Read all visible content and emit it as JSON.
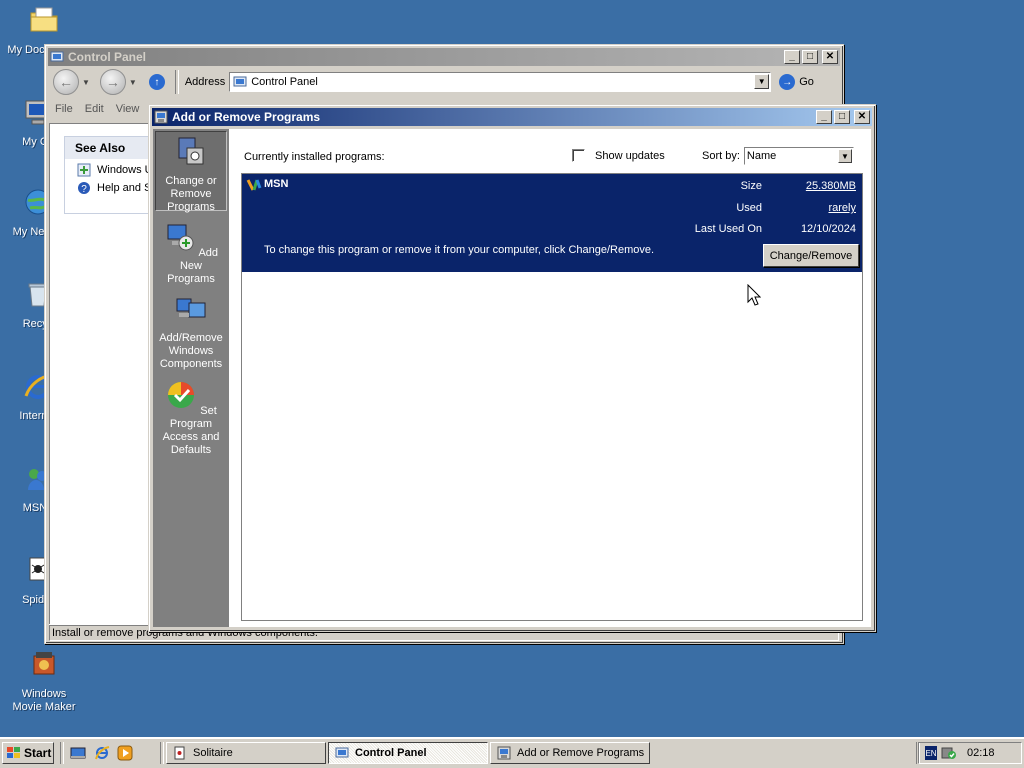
{
  "desktop": {
    "icons": [
      {
        "label": "My Documents",
        "icon": "folder-icon"
      },
      {
        "label": "My Co",
        "icon": "computer-icon"
      },
      {
        "label": "My Ne Pla",
        "icon": "network-places-icon"
      },
      {
        "label": "Recyc",
        "icon": "recycle-bin-icon"
      },
      {
        "label": "Internet",
        "icon": "internet-explorer-icon"
      },
      {
        "label": "MSN I",
        "icon": "msn-icon"
      },
      {
        "label": "Spider",
        "icon": "spider-solitaire-icon"
      },
      {
        "label": "Windows Movie Maker",
        "icon": "movie-maker-icon"
      }
    ]
  },
  "control_panel": {
    "title": "Control Panel",
    "address_label": "Address",
    "address_value": "Control Panel",
    "go_label": "Go",
    "menu": [
      "File",
      "Edit",
      "View"
    ],
    "see_also": {
      "header": "See Also",
      "items": [
        "Windows U",
        "Help and S"
      ]
    },
    "status_text": "Install or remove programs and Windows components."
  },
  "arp": {
    "title": "Add or Remove Programs",
    "side_buttons": [
      {
        "label": "Change or Remove Programs",
        "icon": "change-remove-programs-icon"
      },
      {
        "label": "Add New Programs",
        "icon": "add-new-programs-icon"
      },
      {
        "label": "Add/Remove Windows Components",
        "icon": "windows-components-icon"
      },
      {
        "label": "Set Program Access and Defaults",
        "icon": "program-access-defaults-icon"
      }
    ],
    "currently_installed_label": "Currently installed programs:",
    "show_updates_label": "Show updates",
    "show_updates_checked": false,
    "sort_by_label": "Sort by:",
    "sort_by_value": "Name",
    "program": {
      "name": "MSN",
      "size_label": "Size",
      "size_value": "25.380MB",
      "used_label": "Used",
      "used_value": "rarely",
      "last_used_label": "Last Used On",
      "last_used_value": "12/10/2024",
      "description": "To change this program or remove it from your computer, click Change/Remove.",
      "button_label": "Change/Remove"
    }
  },
  "taskbar": {
    "start_label": "Start",
    "tasks": [
      {
        "label": "Solitaire",
        "active": false
      },
      {
        "label": "Control Panel",
        "active": true
      },
      {
        "label": "Add or Remove Programs",
        "active": false
      }
    ],
    "tray": {
      "language": "EN",
      "clock": "02:18"
    }
  },
  "colors": {
    "desktop": "#3a6ea5",
    "titlebar_active": "#0a246a",
    "selection": "#0a246a",
    "window_face": "#d4d0c8"
  }
}
